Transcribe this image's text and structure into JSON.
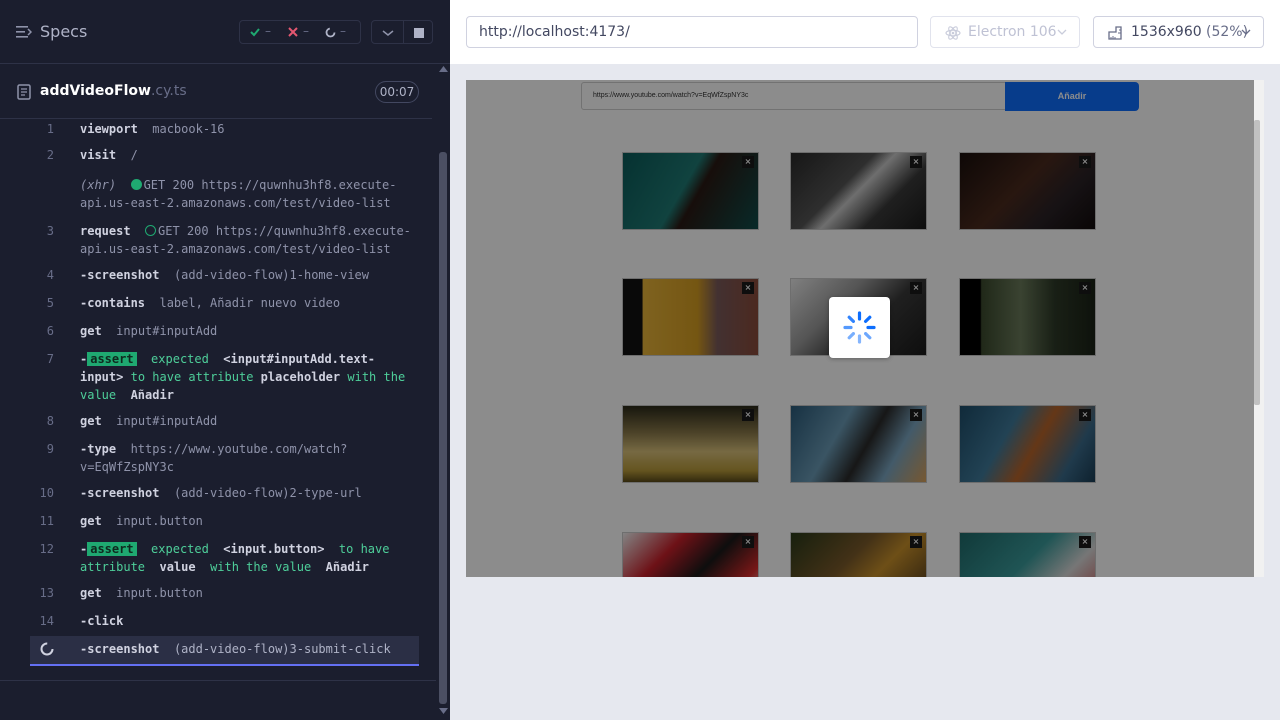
{
  "reporter": {
    "specs_title": "Specs",
    "stats": {
      "passed": "–",
      "failed": "–",
      "pending": "–"
    },
    "file": {
      "name": "addVideoFlow",
      "ext": ".cy.ts",
      "duration": "00:07"
    },
    "commands": [
      {
        "num": "1",
        "name": "viewport",
        "msg": "macbook-16"
      },
      {
        "num": "2",
        "name": "visit",
        "msg": "/"
      },
      {
        "num": "",
        "name": "(xhr)",
        "msg_line1": "GET 200 https://quwnhu3hf8.execute-",
        "msg_line2": "api.us-east-2.amazonaws.com/test/video-list"
      },
      {
        "num": "3",
        "name": "request",
        "msg_line1": "GET 200 https://quwnhu3hf8.execute-",
        "msg_line2": "api.us-east-2.amazonaws.com/test/video-list"
      },
      {
        "num": "4",
        "name": "-screenshot",
        "msg": "(add-video-flow)1-home-view"
      },
      {
        "num": "5",
        "name": "-contains",
        "msg": "label, Añadir nuevo video"
      },
      {
        "num": "6",
        "name": "get",
        "msg": "input#inputAdd"
      },
      {
        "num": "7",
        "prefix": "-",
        "badge": "assert",
        "w1": "expected",
        "w2": "<input#inputAdd.text-",
        "w3": "input>",
        "w4": "to have attribute",
        "w5": "placeholder",
        "w6": "with the",
        "w7": "value",
        "w8": "Añadir"
      },
      {
        "num": "8",
        "name": "get",
        "msg": "input#inputAdd"
      },
      {
        "num": "9",
        "name": "-type",
        "msg_line1": "https://www.youtube.com/watch?",
        "msg_line2": "v=EqWfZspNY3c"
      },
      {
        "num": "10",
        "name": "-screenshot",
        "msg": "(add-video-flow)2-type-url"
      },
      {
        "num": "11",
        "name": "get",
        "msg": "input.button"
      },
      {
        "num": "12",
        "prefix": "-",
        "badge": "assert",
        "w1": "expected",
        "w2": "<input.button>",
        "w3": "to have",
        "w4": "attribute",
        "w5": "value",
        "w6": "with the value",
        "w7": "Añadir"
      },
      {
        "num": "13",
        "name": "get",
        "msg": "input.button"
      },
      {
        "num": "14",
        "name": "-click",
        "msg": ""
      },
      {
        "num": "",
        "name": "-screenshot",
        "msg": "(add-video-flow)3-submit-click"
      }
    ]
  },
  "aut": {
    "url": "http://localhost:4173/",
    "browser": "Electron 106",
    "viewport": "1536x960",
    "scale": "(52%)",
    "app": {
      "input_value": "https://www.youtube.com/watch?v=EqWfZspNY3c",
      "button_label": "Añadir",
      "close_glyph": "×"
    }
  },
  "colors": {
    "accent": "#6470f3",
    "pass": "#1fa971",
    "fail": "#e45770",
    "app_button": "#0d6efd"
  }
}
